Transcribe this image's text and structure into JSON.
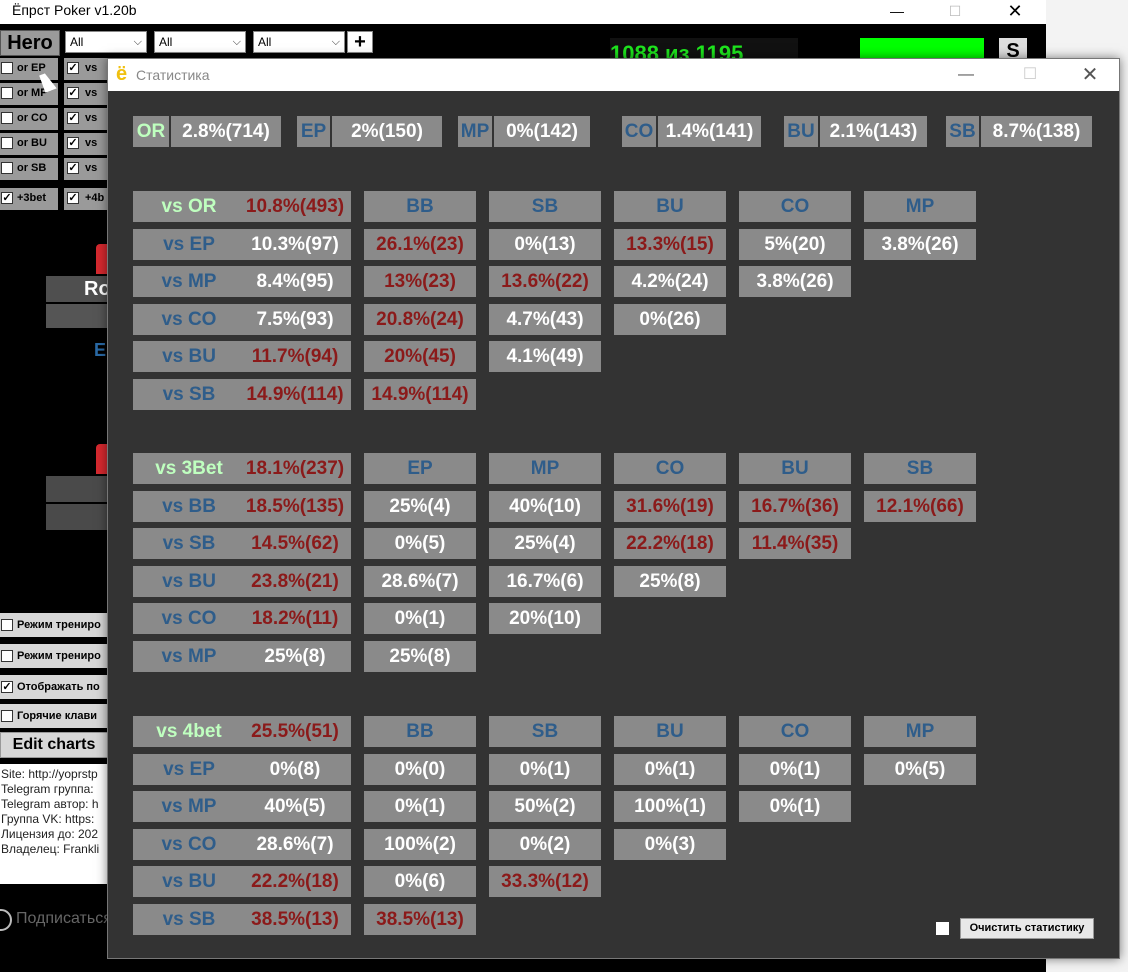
{
  "main_window": {
    "title": "Ёпрст Poker v1.20b",
    "hero_label": "Hero",
    "selects": [
      "All",
      "All",
      "All"
    ],
    "plus_label": "+",
    "counter": "1088 из 1195",
    "s_label": "S",
    "checkbox_rows": [
      {
        "label": "or EP",
        "checked": false
      },
      {
        "label": "or MP",
        "checked": false
      },
      {
        "label": "or CO",
        "checked": false
      },
      {
        "label": "or BU",
        "checked": false
      },
      {
        "label": "or SB",
        "checked": false
      },
      {
        "label": "+3bet",
        "checked": true
      }
    ],
    "checkbox_rows_2": [
      {
        "label": "vs",
        "checked": true
      },
      {
        "label": "vs",
        "checked": true
      },
      {
        "label": "vs",
        "checked": true
      },
      {
        "label": "vs",
        "checked": true
      },
      {
        "label": "vs",
        "checked": true
      },
      {
        "label": "+4b",
        "checked": true
      }
    ],
    "ro_label": "Ro",
    "e_label": "E",
    "mode_rows": [
      {
        "label": "Режим трениро",
        "checked": false
      },
      {
        "label": "Режим трениро",
        "checked": false
      },
      {
        "label": "Отображать по",
        "checked": true
      },
      {
        "label": "Горячие клави",
        "checked": false
      }
    ],
    "edit_charts": "Edit charts",
    "info_lines": [
      "Site: http://yoprstp",
      "Telegram группа:",
      "Telegram автор: h",
      "Группа VK: https:",
      "Лицензия до: 202",
      "Владелец: Frankli"
    ],
    "subscribe": "Подписаться"
  },
  "stats_window": {
    "logo": "ё",
    "title": "Статистика",
    "top_row": [
      {
        "label": "OR",
        "value": "2.8%(714)"
      },
      {
        "label": "EP",
        "value": "2%(150)"
      },
      {
        "label": "MP",
        "value": "0%(142)"
      },
      {
        "label": "CO",
        "value": "1.4%(141)"
      },
      {
        "label": "BU",
        "value": "2.1%(143)"
      },
      {
        "label": "SB",
        "value": "8.7%(138)"
      }
    ],
    "sections": [
      {
        "header": {
          "label": "vs OR",
          "total": "10.8%(493)",
          "cols": [
            "BB",
            "SB",
            "BU",
            "CO",
            "MP"
          ]
        },
        "rows": [
          {
            "label": "vs EP",
            "cells": [
              [
                "10.3%(97)",
                "w"
              ],
              [
                "26.1%(23)",
                "r"
              ],
              [
                "0%(13)",
                "w"
              ],
              [
                "13.3%(15)",
                "r"
              ],
              [
                "5%(20)",
                "w"
              ],
              [
                "3.8%(26)",
                "w"
              ]
            ]
          },
          {
            "label": "vs MP",
            "cells": [
              [
                "8.4%(95)",
                "w"
              ],
              [
                "13%(23)",
                "r"
              ],
              [
                "13.6%(22)",
                "r"
              ],
              [
                "4.2%(24)",
                "w"
              ],
              [
                "3.8%(26)",
                "w"
              ]
            ]
          },
          {
            "label": "vs CO",
            "cells": [
              [
                "7.5%(93)",
                "w"
              ],
              [
                "20.8%(24)",
                "r"
              ],
              [
                "4.7%(43)",
                "w"
              ],
              [
                "0%(26)",
                "w"
              ]
            ]
          },
          {
            "label": "vs BU",
            "cells": [
              [
                "11.7%(94)",
                "r"
              ],
              [
                "20%(45)",
                "r"
              ],
              [
                "4.1%(49)",
                "w"
              ]
            ]
          },
          {
            "label": "vs SB",
            "cells": [
              [
                "14.9%(114)",
                "r"
              ],
              [
                "14.9%(114)",
                "r"
              ]
            ]
          }
        ]
      },
      {
        "header": {
          "label": "vs 3Bet",
          "total": "18.1%(237)",
          "cols": [
            "EP",
            "MP",
            "CO",
            "BU",
            "SB"
          ]
        },
        "rows": [
          {
            "label": "vs BB",
            "cells": [
              [
                "18.5%(135)",
                "r"
              ],
              [
                "25%(4)",
                "w"
              ],
              [
                "40%(10)",
                "w"
              ],
              [
                "31.6%(19)",
                "r"
              ],
              [
                "16.7%(36)",
                "r"
              ],
              [
                "12.1%(66)",
                "r"
              ]
            ]
          },
          {
            "label": "vs SB",
            "cells": [
              [
                "14.5%(62)",
                "r"
              ],
              [
                "0%(5)",
                "w"
              ],
              [
                "25%(4)",
                "w"
              ],
              [
                "22.2%(18)",
                "r"
              ],
              [
                "11.4%(35)",
                "r"
              ]
            ]
          },
          {
            "label": "vs BU",
            "cells": [
              [
                "23.8%(21)",
                "r"
              ],
              [
                "28.6%(7)",
                "w"
              ],
              [
                "16.7%(6)",
                "w"
              ],
              [
                "25%(8)",
                "w"
              ]
            ]
          },
          {
            "label": "vs CO",
            "cells": [
              [
                "18.2%(11)",
                "r"
              ],
              [
                "0%(1)",
                "w"
              ],
              [
                "20%(10)",
                "w"
              ]
            ]
          },
          {
            "label": "vs MP",
            "cells": [
              [
                "25%(8)",
                "w"
              ],
              [
                "25%(8)",
                "w"
              ]
            ]
          }
        ]
      },
      {
        "header": {
          "label": "vs 4bet",
          "total": "25.5%(51)",
          "cols": [
            "BB",
            "SB",
            "BU",
            "CO",
            "MP"
          ]
        },
        "rows": [
          {
            "label": "vs EP",
            "cells": [
              [
                "0%(8)",
                "w"
              ],
              [
                "0%(0)",
                "w"
              ],
              [
                "0%(1)",
                "w"
              ],
              [
                "0%(1)",
                "w"
              ],
              [
                "0%(1)",
                "w"
              ],
              [
                "0%(5)",
                "w"
              ]
            ]
          },
          {
            "label": "vs MP",
            "cells": [
              [
                "40%(5)",
                "w"
              ],
              [
                "0%(1)",
                "w"
              ],
              [
                "50%(2)",
                "w"
              ],
              [
                "100%(1)",
                "w"
              ],
              [
                "0%(1)",
                "w"
              ]
            ]
          },
          {
            "label": "vs CO",
            "cells": [
              [
                "28.6%(7)",
                "w"
              ],
              [
                "100%(2)",
                "w"
              ],
              [
                "0%(2)",
                "w"
              ],
              [
                "0%(3)",
                "w"
              ]
            ]
          },
          {
            "label": "vs BU",
            "cells": [
              [
                "22.2%(18)",
                "r"
              ],
              [
                "0%(6)",
                "w"
              ],
              [
                "33.3%(12)",
                "r"
              ]
            ]
          },
          {
            "label": "vs SB",
            "cells": [
              [
                "38.5%(13)",
                "r"
              ],
              [
                "38.5%(13)",
                "r"
              ]
            ]
          }
        ]
      }
    ],
    "clear_label": "Очистить статистику"
  },
  "colors": {
    "cell_bg": "#8a8a8a",
    "window_bg": "#333333",
    "header_green": "#bfffbf",
    "position_blue": "#2f5d8a",
    "value_red": "#8b1a1a",
    "value_white": "#ffffff"
  }
}
